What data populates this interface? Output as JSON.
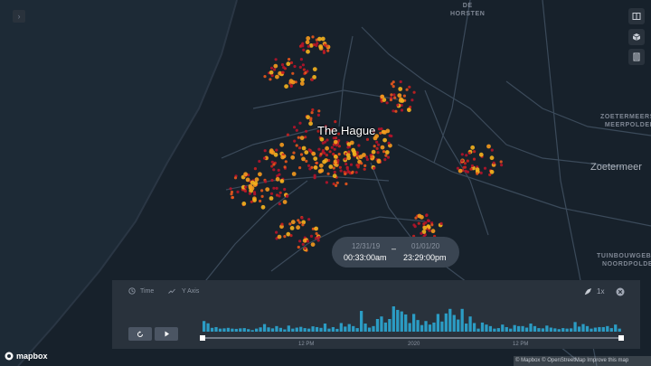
{
  "map": {
    "labels": {
      "de_horsten": "DE\nHORSTEN",
      "the_hague": "The Hague",
      "zoetermeerse_meerpolder": "ZOETERMEERSE\nMEERPOLDER",
      "zoetermeer": "Zoetermeer",
      "tuinbouwgebied": "TUINBOUWGEBIED\nNOORDPOLDER"
    },
    "colors": {
      "water": "#1d2a36",
      "land": "#17212b",
      "roads": "#3b4a5a",
      "point_low": "#b5132a",
      "point_mid": "#e8571c",
      "point_high": "#f5b21d"
    }
  },
  "controls": {
    "sidebar_toggle_icon": "chevron-right-icon",
    "right": [
      "split-map-icon",
      "3d-cube-icon",
      "legend-icon"
    ]
  },
  "time_display": {
    "start_date": "12/31/19",
    "start_time": "00:33:00am",
    "separator": "–",
    "end_date": "01/01/20",
    "end_time": "23:29:00pm"
  },
  "timeline": {
    "tab_time": "Time",
    "tab_y_axis": "Y Axis",
    "speed": "1x",
    "axis_labels": [
      "12 PM",
      "2020",
      "12 PM"
    ],
    "histogram": [
      0.42,
      0.33,
      0.15,
      0.18,
      0.12,
      0.13,
      0.15,
      0.12,
      0.11,
      0.13,
      0.14,
      0.1,
      0.06,
      0.12,
      0.17,
      0.3,
      0.17,
      0.13,
      0.22,
      0.15,
      0.09,
      0.24,
      0.12,
      0.16,
      0.19,
      0.14,
      0.12,
      0.21,
      0.18,
      0.15,
      0.32,
      0.12,
      0.18,
      0.11,
      0.34,
      0.2,
      0.3,
      0.22,
      0.14,
      0.82,
      0.32,
      0.16,
      0.22,
      0.5,
      0.6,
      0.36,
      0.5,
      1.0,
      0.86,
      0.8,
      0.68,
      0.34,
      0.7,
      0.46,
      0.26,
      0.42,
      0.28,
      0.36,
      0.7,
      0.4,
      0.72,
      0.9,
      0.66,
      0.48,
      0.9,
      0.32,
      0.6,
      0.34,
      0.12,
      0.36,
      0.28,
      0.22,
      0.12,
      0.14,
      0.28,
      0.18,
      0.12,
      0.26,
      0.22,
      0.22,
      0.16,
      0.32,
      0.22,
      0.14,
      0.13,
      0.24,
      0.16,
      0.13,
      0.1,
      0.14,
      0.12,
      0.13,
      0.38,
      0.2,
      0.3,
      0.22,
      0.12,
      0.16,
      0.18,
      0.18,
      0.22,
      0.14,
      0.28,
      0.12
    ]
  },
  "branding": {
    "logo": "mapbox",
    "attribution": "© Mapbox © OpenStreetMap Improve this map"
  }
}
